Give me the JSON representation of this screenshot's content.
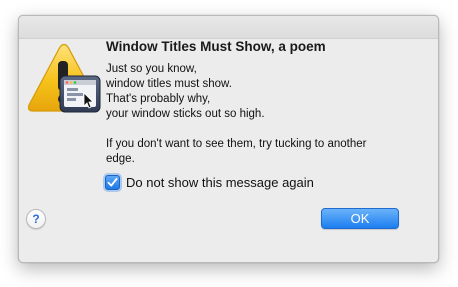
{
  "dialog": {
    "title": "Window Titles Must Show, a poem",
    "message_lines": [
      "Just so you know,",
      "window titles must show.",
      "That's probably why,",
      "your window sticks out so high."
    ],
    "message_paragraph_2": "If you don't want to see them, try tucking to another edge.",
    "checkbox": {
      "label": "Do not show this message again",
      "checked": true
    },
    "help_label": "?",
    "ok_label": "OK"
  },
  "icons": {
    "app_icon": "warning-triangle-with-window-icon",
    "checkmark": "checkmark-icon"
  },
  "colors": {
    "accent": "#1d7ef0",
    "warning": "#f4c21b",
    "dialog_bg": "#ececec"
  }
}
